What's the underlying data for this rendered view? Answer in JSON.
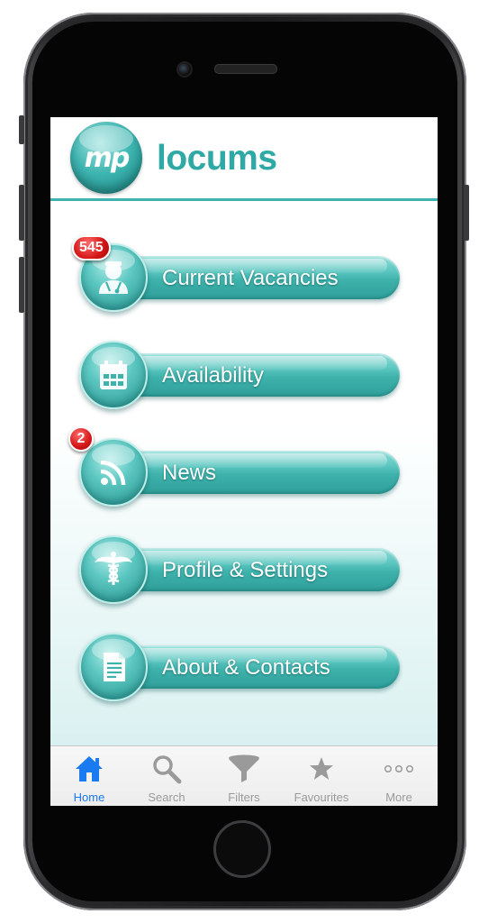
{
  "app": {
    "brand_text": "locums",
    "logo_text": "mp"
  },
  "menu": [
    {
      "label": "Current Vacancies",
      "icon": "doctor-icon",
      "badge": "545"
    },
    {
      "label": "Availability",
      "icon": "calendar-icon",
      "badge": null
    },
    {
      "label": "News",
      "icon": "rss-icon",
      "badge": "2"
    },
    {
      "label": "Profile & Settings",
      "icon": "caduceus-icon",
      "badge": null
    },
    {
      "label": "About & Contacts",
      "icon": "document-icon",
      "badge": null
    }
  ],
  "tabbar": [
    {
      "label": "Home",
      "icon": "home-icon",
      "active": true
    },
    {
      "label": "Search",
      "icon": "search-icon",
      "active": false
    },
    {
      "label": "Filters",
      "icon": "filter-icon",
      "active": false
    },
    {
      "label": "Favourites",
      "icon": "star-icon",
      "active": false
    },
    {
      "label": "More",
      "icon": "more-icon",
      "active": false
    }
  ],
  "colors": {
    "accent": "#3fb3b0",
    "badge": "#d41616",
    "tab_active": "#1a7af0",
    "tab_inactive": "#9a9a9a"
  }
}
